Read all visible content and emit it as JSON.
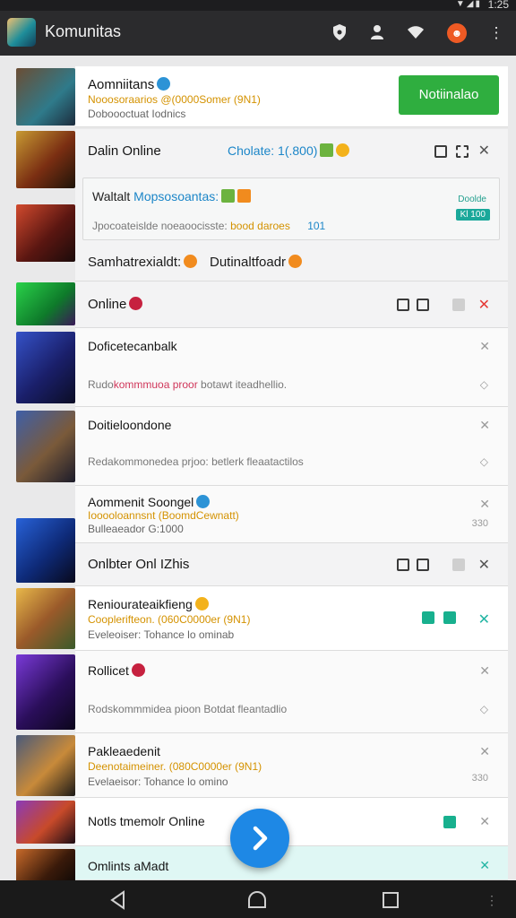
{
  "status_bar": {
    "time": "1:25"
  },
  "app_bar": {
    "title": "Komunitas",
    "icons": [
      "shield-icon",
      "person-icon",
      "wifi-icon",
      "orange-badge-icon",
      "more-vert-icon"
    ]
  },
  "rows": {
    "r1": {
      "title": "Aomniitans",
      "sub": "Nooosoraarios @(0000Somer (9N1)",
      "meta": "Doboooctuat Iodnics",
      "button": "Notiinalao"
    },
    "r2": {
      "title": "Dalin Online",
      "status": "Cholate: 1(.800)",
      "inner_title": "Waltalt",
      "inner_title_blue": "Mopsosoantas:",
      "inner_msg": "Jpocoateislde noeaoocisste:",
      "inner_msg_orange": "bood daroes",
      "inner_num": "101",
      "badge_label": "Doolde",
      "badge": "Kl 100"
    },
    "r3": {
      "left": "Samhatrexialdt:",
      "right": "Dutinaltfoadr"
    },
    "r4": {
      "title": "Online"
    },
    "r5": {
      "title": "Doficetecanbalk",
      "msg_plain": "Rudo",
      "msg_pink": "kommmuoa proor",
      "msg_rest": " botawt iteadhellio."
    },
    "r6": {
      "title": "Doitieloondone",
      "msg": "Redakommonedea prjoo: betlerk fleaatactilos"
    },
    "r7": {
      "title": "Aommenit Soongel",
      "sub": "Iooooloannsnt (BoomdCewnatt)",
      "meta": "Bulleaeador G:1000",
      "num": "330"
    },
    "r8": {
      "title": "Onlbter Onl IZhis"
    },
    "r9": {
      "title": "Reniourateaikfieng",
      "sub": "Cooplerifteon. (060C0000er (9N1)",
      "meta": "Eveleoiser: Tohance lo ominab"
    },
    "r10": {
      "title": "Rollicet",
      "msg": "Rodskommmidea pioon Botdat fleantadlio"
    },
    "r11": {
      "title": "Pakleaedenit",
      "sub": "Deenotaimeiner. (080C0000er (9N1)",
      "meta": "Evelaeisor: Tohance lo omino",
      "num": "330"
    },
    "r12": {
      "title": "Notls tmemolr Online"
    },
    "r13": {
      "title": "Omlints aMadt"
    }
  },
  "colors": {
    "accent_green": "#2fae3f",
    "fab_blue": "#1e88e5",
    "app_bar": "#2b2b2d"
  }
}
